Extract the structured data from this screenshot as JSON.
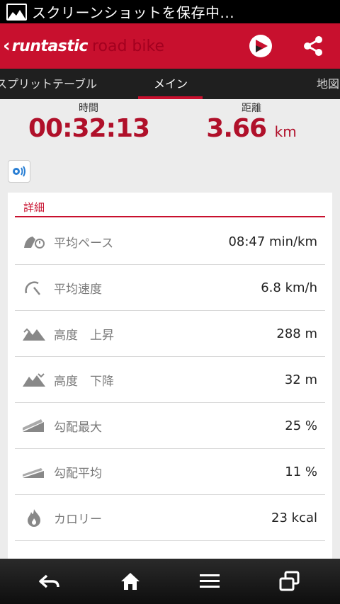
{
  "status_bar": {
    "text": "スクリーンショットを保存中..."
  },
  "app_bar": {
    "back_glyph": "‹",
    "brand": "runtastic",
    "product": "road bike",
    "actions": [
      "play-icon",
      "share-icon"
    ]
  },
  "tabs": [
    {
      "label": "スプリットテーブル"
    },
    {
      "label": "メイン",
      "active": true
    },
    {
      "label": "地図"
    }
  ],
  "summary": {
    "time_label": "時間",
    "time_value": "00:32:13",
    "distance_label": "距離",
    "distance_value": "3.66",
    "distance_unit": "km"
  },
  "details": {
    "header": "詳細",
    "rows": [
      {
        "icon": "pace-icon",
        "label": "平均ペース",
        "value": "08:47 min/km"
      },
      {
        "icon": "speedometer-icon",
        "label": "平均速度",
        "value": "6.8  km/h"
      },
      {
        "icon": "elevation-gain-icon",
        "label": "高度　上昇",
        "value": "288 m"
      },
      {
        "icon": "elevation-loss-icon",
        "label": "高度　下降",
        "value": "32 m"
      },
      {
        "icon": "max-gradient-icon",
        "label": "勾配最大",
        "value": "25 %"
      },
      {
        "icon": "avg-gradient-icon",
        "label": "勾配平均",
        "value": "11 %"
      },
      {
        "icon": "flame-icon",
        "label": "カロリー",
        "value": "23 kcal"
      }
    ]
  },
  "colors": {
    "brand_red": "#c8102e",
    "value_red": "#b0102a"
  },
  "nav_bar": [
    "back-icon",
    "home-icon",
    "menu-icon",
    "recent-apps-icon"
  ]
}
